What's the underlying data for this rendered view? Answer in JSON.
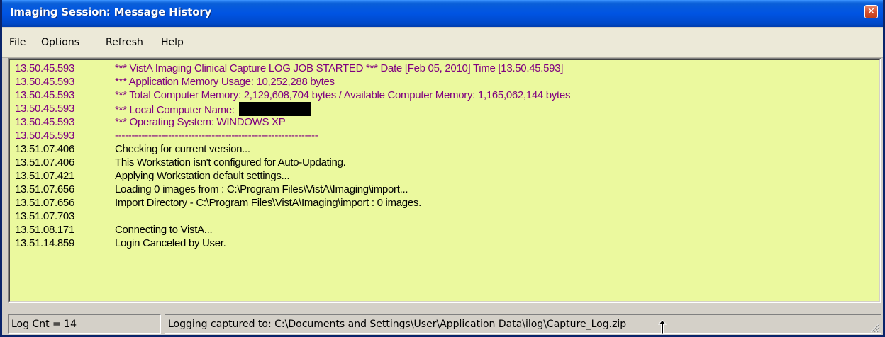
{
  "window": {
    "title": "Imaging Session:  Message History",
    "close_icon": "close-icon"
  },
  "menu": {
    "items": [
      "File",
      "Options",
      "Refresh",
      "Help"
    ]
  },
  "log": {
    "background": "#ebf99e",
    "colors": {
      "header": "#800080",
      "normal": "#000000"
    },
    "rows": [
      {
        "time": "13.50.45.593",
        "text": "*** VistA Imaging Clinical Capture LOG JOB STARTED *** Date [Feb 05, 2010] Time [13.50.45.593]",
        "style": "purple"
      },
      {
        "time": "13.50.45.593",
        "text": "*** Application Memory Usage:      10,252,288 bytes",
        "style": "purple"
      },
      {
        "time": "13.50.45.593",
        "text": "*** Total Computer Memory:  2,129,608,704 bytes / Available Computer Memory:  1,165,062,144 bytes",
        "style": "purple"
      },
      {
        "time": "13.50.45.593",
        "text": "*** Local Computer Name: ",
        "style": "purple",
        "redacted": true
      },
      {
        "time": "13.50.45.593",
        "text": "*** Operating System: WINDOWS XP",
        "style": "purple"
      },
      {
        "time": "13.50.45.593",
        "text": "-------------------------------------------------------------",
        "style": "purple"
      },
      {
        "time": "13.51.07.406",
        "text": "Checking for current version...",
        "style": "black"
      },
      {
        "time": "13.51.07.406",
        "text": "This Workstation isn't configured for Auto-Updating.",
        "style": "black"
      },
      {
        "time": "13.51.07.421",
        "text": "Applying Workstation default settings...",
        "style": "black"
      },
      {
        "time": "13.51.07.656",
        "text": "Loading 0 images from : C:\\Program Files\\VistA\\Imaging\\import...",
        "style": "black"
      },
      {
        "time": "13.51.07.656",
        "text": "Import Directory  -  C:\\Program Files\\VistA\\Imaging\\import : 0 images.",
        "style": "black"
      },
      {
        "time": "13.51.07.703",
        "text": "",
        "style": "black"
      },
      {
        "time": "13.51.08.171",
        "text": "Connecting to VistA...",
        "style": "black"
      },
      {
        "time": "13.51.14.859",
        "text": "Login Canceled by User.",
        "style": "black"
      }
    ]
  },
  "status": {
    "log_count": "Log Cnt = 14",
    "logging_path": "Logging captured to: C:\\Documents and Settings\\User\\Application Data\\ilog\\Capture_Log.zip"
  }
}
